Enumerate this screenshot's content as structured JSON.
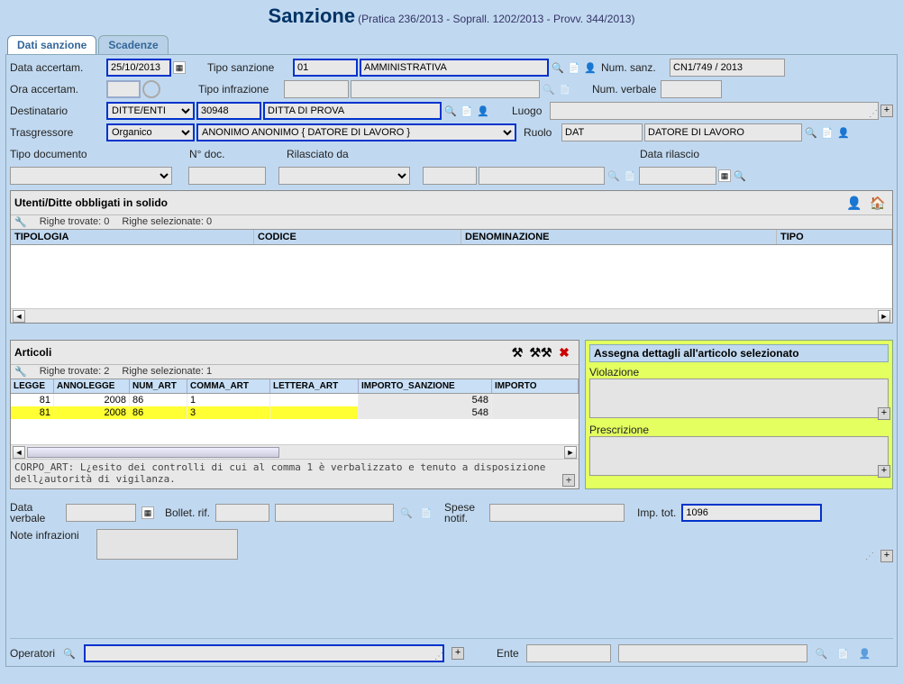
{
  "title": {
    "main": "Sanzione",
    "sub": "(Pratica 236/2013 - Soprall. 1202/2013 - Provv. 344/2013)"
  },
  "tabs": {
    "t1": "Dati sanzione",
    "t2": "Scadenze"
  },
  "form": {
    "data_accertam_lbl": "Data accertam.",
    "data_accertam": "25/10/2013",
    "tipo_sanzione_lbl": "Tipo sanzione",
    "tipo_sanzione_code": "01",
    "tipo_sanzione_desc": "AMMINISTRATIVA",
    "num_sanz_lbl": "Num. sanz.",
    "num_sanz": "CN1/749 / 2013",
    "ora_accertam_lbl": "Ora accertam.",
    "ora_accertam": "",
    "tipo_infrazione_lbl": "Tipo infrazione",
    "tipo_infrazione_code": "",
    "tipo_infrazione_desc": "",
    "num_verbale_lbl": "Num. verbale",
    "num_verbale": "",
    "destinatario_lbl": "Destinatario",
    "destinatario_type": "DITTE/ENTI",
    "destinatario_code": "30948",
    "destinatario_desc": "DITTA DI PROVA",
    "luogo_lbl": "Luogo",
    "luogo": "",
    "trasgressore_lbl": "Trasgressore",
    "trasgressore_type": "Organico",
    "trasgressore_desc": "ANONIMO ANONIMO { DATORE DI LAVORO }",
    "ruolo_lbl": "Ruolo",
    "ruolo_code": "DAT",
    "ruolo_desc": "DATORE DI LAVORO",
    "tipo_documento_lbl": "Tipo documento",
    "n_doc_lbl": "N° doc.",
    "rilasciato_da_lbl": "Rilasciato da",
    "data_rilascio_lbl": "Data rilascio"
  },
  "solido": {
    "title": "Utenti/Ditte obbligati in solido",
    "righe_trovate_lbl": "Righe trovate:",
    "righe_trovate": "0",
    "righe_selezionate_lbl": "Righe selezionate:",
    "righe_selezionate": "0",
    "cols": {
      "tipologia": "TIPOLOGIA",
      "codice": "CODICE",
      "denominazione": "DENOMINAZIONE",
      "tipo": "TIPO"
    }
  },
  "articoli": {
    "title": "Articoli",
    "righe_trovate_lbl": "Righe trovate:",
    "righe_trovate": "2",
    "righe_selezionate_lbl": "Righe selezionate:",
    "righe_selezionate": "1",
    "cols": {
      "legge": "LEGGE",
      "annolegge": "ANNOLEGGE",
      "num_art": "NUM_ART",
      "comma_art": "COMMA_ART",
      "lettera_art": "LETTERA_ART",
      "importo_sanzione": "IMPORTO_SANZIONE",
      "importo": "IMPORTO"
    },
    "rows": [
      {
        "legge": "81",
        "annolegge": "2008",
        "num_art": "86",
        "comma_art": "1",
        "lettera_art": "",
        "importo_sanzione": "548",
        "importo": ""
      },
      {
        "legge": "81",
        "annolegge": "2008",
        "num_art": "86",
        "comma_art": "3",
        "lettera_art": "",
        "importo_sanzione": "548",
        "importo": ""
      }
    ],
    "corpo_art": "CORPO_ART: L¿esito dei controlli di cui al comma 1 è verbalizzato e tenuto a disposizione dell¿autorità di vigilanza."
  },
  "dettagli": {
    "title": "Assegna dettagli all'articolo selezionato",
    "violazione_lbl": "Violazione",
    "violazione": "",
    "prescrizione_lbl": "Prescrizione",
    "prescrizione": ""
  },
  "bottom": {
    "data_verbale_lbl": "Data verbale",
    "bollet_rif_lbl": "Bollet. rif.",
    "spese_notif_lbl": "Spese notif.",
    "imp_tot_lbl": "Imp. tot.",
    "imp_tot": "1096",
    "note_infrazioni_lbl": "Note infrazioni"
  },
  "footer": {
    "operatori_lbl": "Operatori",
    "ente_lbl": "Ente"
  }
}
